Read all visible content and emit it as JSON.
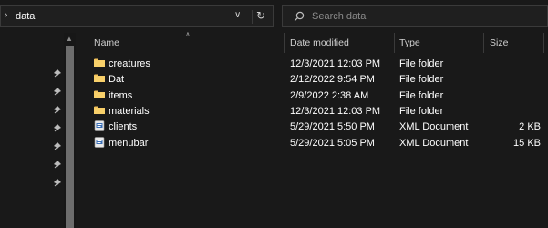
{
  "address": {
    "crumb": "data"
  },
  "search": {
    "placeholder": "Search data"
  },
  "columns": {
    "name": "Name",
    "date": "Date modified",
    "type": "Type",
    "size": "Size"
  },
  "files": [
    {
      "name": "creatures",
      "date": "12/3/2021 12:03 PM",
      "type": "File folder",
      "size": "",
      "icon": "folder-icon"
    },
    {
      "name": "Dat",
      "date": "2/12/2022 9:54 PM",
      "type": "File folder",
      "size": "",
      "icon": "folder-icon"
    },
    {
      "name": "items",
      "date": "2/9/2022 2:38 AM",
      "type": "File folder",
      "size": "",
      "icon": "folder-icon"
    },
    {
      "name": "materials",
      "date": "12/3/2021 12:03 PM",
      "type": "File folder",
      "size": "",
      "icon": "folder-icon"
    },
    {
      "name": "clients",
      "date": "5/29/2021 5:50 PM",
      "type": "XML Document",
      "size": "2 KB",
      "icon": "xml-file-icon"
    },
    {
      "name": "menubar",
      "date": "5/29/2021 5:05 PM",
      "type": "XML Document",
      "size": "15 KB",
      "icon": "xml-file-icon"
    }
  ],
  "colors": {
    "background": "#191919",
    "folder": "#f3c25b",
    "text": "#ffffff",
    "muted": "#8a8a8a"
  }
}
